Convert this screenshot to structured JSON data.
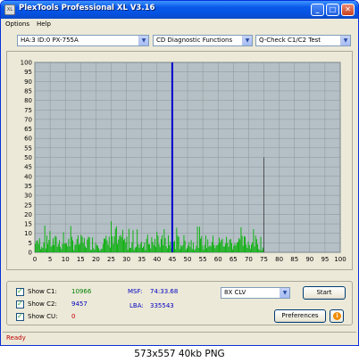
{
  "window": {
    "title": "PlexTools Professional XL V3.16",
    "app_icon": "XL",
    "buttons": {
      "minimize": "_",
      "maximize": "□",
      "close": "✕"
    }
  },
  "menu": [
    "Options",
    "Help"
  ],
  "toolbar": {
    "drive": "HA:3 ID:0  PX-755A",
    "function": "CD Diagnostic Functions",
    "test": "Q-Check C1/C2 Test",
    "arrow_glyph": "▼"
  },
  "chart_data": {
    "type": "bar",
    "x_ticks": [
      0,
      5,
      10,
      15,
      20,
      25,
      30,
      35,
      40,
      45,
      50,
      55,
      60,
      65,
      70,
      75,
      80,
      85,
      90,
      95,
      100
    ],
    "y_ticks": [
      0,
      5,
      10,
      15,
      20,
      25,
      30,
      35,
      40,
      45,
      50,
      55,
      60,
      65,
      70,
      75,
      80,
      85,
      90,
      95,
      100
    ],
    "xlim": [
      0,
      100
    ],
    "ylim": [
      0,
      100
    ],
    "grid": true,
    "disc_end_x": 75,
    "disc_end_marker_y": 50,
    "position_cursor_x": 45,
    "series": [
      {
        "type": "c1_error_bars",
        "color": "#00b000",
        "x_range": [
          0,
          75
        ],
        "typical_max": 11,
        "peak": 18
      }
    ],
    "colors": {
      "background": "#b4c0c6",
      "cursor": "#0000cc",
      "marker": "#505050",
      "gridline": "#8a9499"
    }
  },
  "results": {
    "c1_label": "Show C1:",
    "c1_value": "10966",
    "c2_label": "Show C2:",
    "c2_value": "9457",
    "cu_label": "Show CU:",
    "cu_value": "0",
    "msf_label": "MSF:",
    "msf_value": "74:33.68",
    "lba_label": "LBA:",
    "lba_value": "335543"
  },
  "controls": {
    "speed": "8X CLV",
    "start": "Start",
    "preferences": "Preferences",
    "info_glyph": "i"
  },
  "status": "Ready",
  "caption": "573x557  40kb  PNG"
}
